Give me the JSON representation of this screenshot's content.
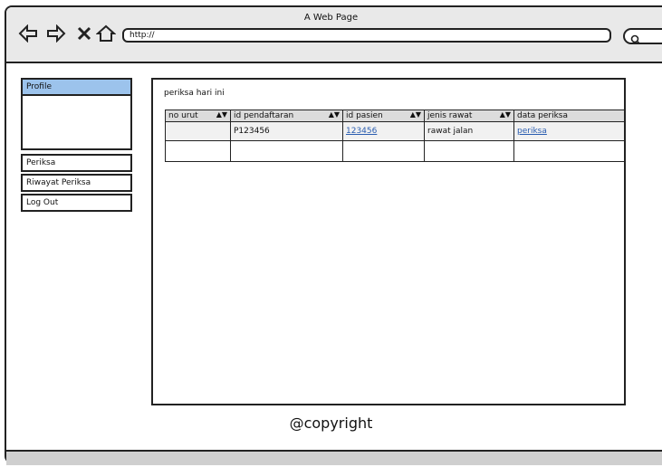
{
  "browser": {
    "title": "A Web Page",
    "url": "http://"
  },
  "sidebar": {
    "items": [
      {
        "label": "Profile"
      },
      {
        "label": "Periksa"
      },
      {
        "label": "Riwayat Periksa"
      },
      {
        "label": "Log Out"
      }
    ]
  },
  "main": {
    "section_title": "periksa hari ini",
    "table": {
      "headers": [
        "no urut",
        "id pendaftaran",
        "id pasien",
        "jenis rawat",
        "data periksa"
      ],
      "rows": [
        [
          "",
          "P123456",
          "123456",
          "rawat jalan",
          "periksa"
        ],
        [
          "",
          "",
          "",
          "",
          ""
        ]
      ]
    }
  },
  "footer": {
    "text": "@copyright"
  },
  "icons": {
    "back": "arrow-left-icon",
    "forward": "arrow-right-icon",
    "stop": "close-icon",
    "home": "home-icon",
    "search": "search-icon"
  },
  "colors": {
    "active_sidebar": "#9cc3ec",
    "link": "#2a5db0"
  }
}
